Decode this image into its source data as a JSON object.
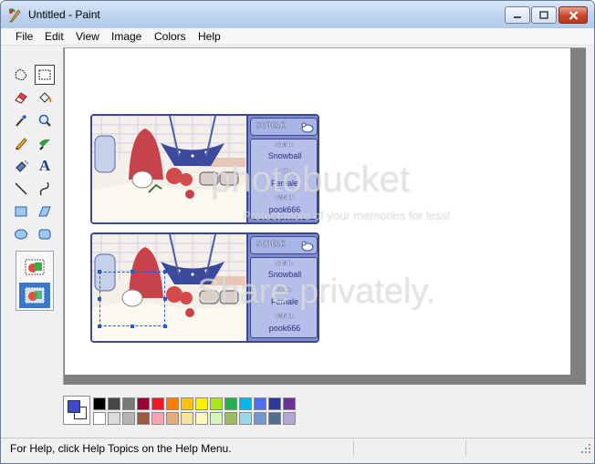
{
  "window": {
    "title": "Untitled - Paint",
    "app_icon": "paint-app-icon",
    "controls": [
      "minimize-icon",
      "maximize-icon",
      "close-icon"
    ]
  },
  "menu": [
    "File",
    "Edit",
    "View",
    "Image",
    "Colors",
    "Help"
  ],
  "tools": [
    {
      "name": "free-form-select",
      "icon": "freeform-select-icon"
    },
    {
      "name": "select",
      "icon": "rect-select-icon",
      "selected": true
    },
    {
      "name": "eraser",
      "icon": "eraser-icon"
    },
    {
      "name": "fill-with-color",
      "icon": "fill-bucket-icon"
    },
    {
      "name": "pick-color",
      "icon": "eyedropper-icon"
    },
    {
      "name": "magnifier",
      "icon": "magnifier-icon"
    },
    {
      "name": "pencil",
      "icon": "pencil-icon"
    },
    {
      "name": "brush",
      "icon": "brush-icon"
    },
    {
      "name": "airbrush",
      "icon": "airbrush-icon"
    },
    {
      "name": "text",
      "icon": "text-icon",
      "glyph": "A"
    },
    {
      "name": "line",
      "icon": "line-icon"
    },
    {
      "name": "curve",
      "icon": "curve-icon"
    },
    {
      "name": "rectangle",
      "icon": "rectangle-icon"
    },
    {
      "name": "polygon",
      "icon": "polygon-icon"
    },
    {
      "name": "ellipse",
      "icon": "ellipse-icon"
    },
    {
      "name": "rounded-rectangle",
      "icon": "rounded-rect-icon"
    }
  ],
  "tool_options": [
    {
      "name": "opaque-selection",
      "icon": "opaque-selection-icon",
      "selected": false
    },
    {
      "name": "transparent-selection",
      "icon": "transparent-selection-icon",
      "selected": true
    }
  ],
  "canvas": {
    "cards": [
      {
        "header": "SQUEAK",
        "name_label": "NAME:",
        "name": "Snowball",
        "sex_label": "SEX:",
        "sex": "Female",
        "owner_label": "OWNER",
        "owner": "pook666"
      },
      {
        "header": "SQUEAK",
        "name_label": "NAME:",
        "name": "Snowball",
        "sex_label": "SEX:",
        "sex": "Female",
        "owner_label": "OWNER",
        "owner": "pook666"
      }
    ],
    "watermarks": [
      "photobucket",
      "Protect more of your memories for less!",
      "Share privately."
    ]
  },
  "colors": {
    "foreground": "#3f48cc",
    "background": "#ffffff",
    "palette_row1": [
      "#000000",
      "#464646",
      "#787878",
      "#990030",
      "#ed1c24",
      "#ff7e00",
      "#ffc20e",
      "#fff200",
      "#a8e61d",
      "#22b14c",
      "#00b7ef",
      "#4d6df3",
      "#2f3699",
      "#6f3198"
    ],
    "palette_row2": [
      "#ffffff",
      "#dcdcdc",
      "#b4b4b4",
      "#9c5a3c",
      "#ffa3b1",
      "#e5aa7a",
      "#f5e49c",
      "#fff9bd",
      "#d3f9bc",
      "#9dbb61",
      "#99d9ea",
      "#709ad1",
      "#546d8e",
      "#b5a5d5"
    ]
  },
  "status": {
    "help_text": "For Help, click Help Topics on the Help Menu."
  }
}
